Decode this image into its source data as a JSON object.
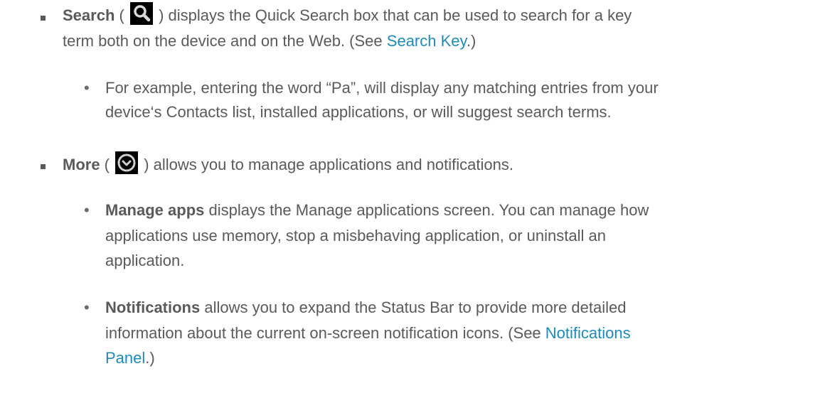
{
  "search": {
    "bold": "Search",
    "open_paren": " ( ",
    "icon": "search-icon",
    "after_icon": " ) displays the Quick Search box that can be used to search for a key",
    "line2_pre": "term both on the device and on the Web. (See ",
    "link": "Search Key",
    "line2_post": ".)",
    "sub": {
      "line1": "For example, entering the word “Pa”, will display any matching entries from your",
      "line2": "device‘s Contacts list, installed applications, or will suggest search terms."
    }
  },
  "more": {
    "bold": "More",
    "open_paren": " ( ",
    "icon": "chevron-down-circle-icon",
    "after_icon": " ) allows you to manage applications and notifications.",
    "manage": {
      "bold": "Manage apps",
      "line1_rest": " displays the Manage applications screen. You can manage how",
      "line2": "applications use memory, stop a misbehaving application, or uninstall an",
      "line3": "application."
    },
    "notifications": {
      "bold": "Notifications",
      "line1_rest": " allows you to expand the Status Bar to provide more detailed",
      "line2_pre": "information about the current on-screen notification icons. (See ",
      "link_part1": "Notifications",
      "link_part2": "Panel",
      "line3_post": ".)"
    }
  },
  "colors": {
    "text": "#5a5a5a",
    "link": "#1f8bb5",
    "icon_bg": "#000000"
  }
}
